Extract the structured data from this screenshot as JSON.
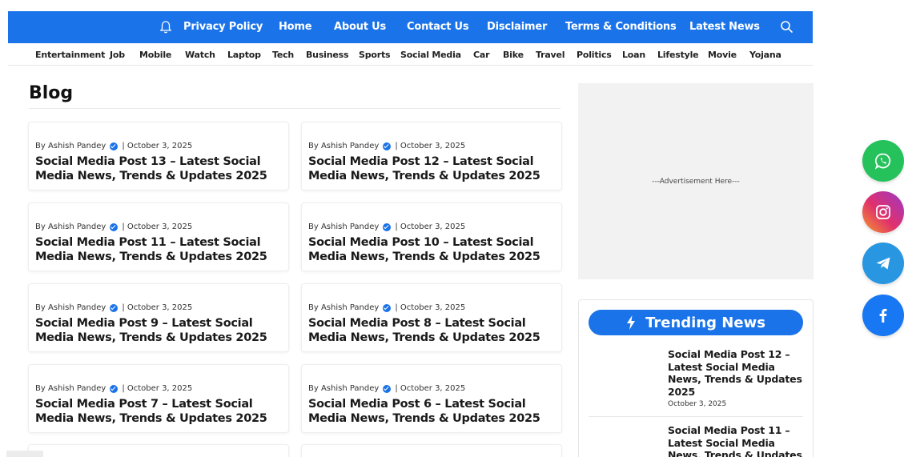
{
  "topnav": {
    "links": [
      "Privacy Policy",
      "Home",
      "About Us",
      "Contact Us",
      "Disclaimer",
      "Terms & Conditions",
      "Latest News"
    ],
    "bell_icon": "bell-icon",
    "search_icon": "search-icon",
    "bg_color": "#1a73e8"
  },
  "categories": [
    "Entertainment",
    "Job",
    "Mobile",
    "Watch",
    "Laptop",
    "Tech",
    "Business",
    "Sports",
    "Social Media",
    "Car",
    "Bike",
    "Travel",
    "Politics",
    "Loan",
    "Lifestyle",
    "Movie",
    "Yojana"
  ],
  "blog": {
    "heading": "Blog",
    "posts": [
      {
        "author": "By Ashish Pandey",
        "date": "| October 3, 2025",
        "title": "Social Media Post 13 – Latest Social Media News, Trends & Updates 2025"
      },
      {
        "author": "By Ashish Pandey",
        "date": "| October 3, 2025",
        "title": "Social Media Post 12 – Latest Social Media News, Trends & Updates 2025"
      },
      {
        "author": "By Ashish Pandey",
        "date": "| October 3, 2025",
        "title": "Social Media Post 11 – Latest Social Media News, Trends & Updates 2025"
      },
      {
        "author": "By Ashish Pandey",
        "date": "| October 3, 2025",
        "title": "Social Media Post 10 – Latest Social Media News, Trends & Updates 2025"
      },
      {
        "author": "By Ashish Pandey",
        "date": "| October 3, 2025",
        "title": "Social Media Post 9 – Latest Social Media News, Trends & Updates 2025"
      },
      {
        "author": "By Ashish Pandey",
        "date": "| October 3, 2025",
        "title": "Social Media Post 8 – Latest Social Media News, Trends & Updates 2025"
      },
      {
        "author": "By Ashish Pandey",
        "date": "| October 3, 2025",
        "title": "Social Media Post 7 – Latest Social Media News, Trends & Updates 2025"
      },
      {
        "author": "By Ashish Pandey",
        "date": "| October 3, 2025",
        "title": "Social Media Post 6 – Latest Social Media News, Trends & Updates 2025"
      }
    ]
  },
  "sidebar": {
    "ad_text": "---Advertisement Here---",
    "trending": {
      "heading": "Trending News",
      "items": [
        {
          "title": "Social Media Post 12 – Latest Social Media News, Trends & Updates 2025",
          "date": "October 3, 2025"
        },
        {
          "title": "Social Media Post 11 – Latest Social Media News, Trends & Updates",
          "date": ""
        }
      ]
    }
  },
  "social_icons": [
    "whatsapp-icon",
    "instagram-icon",
    "telegram-icon",
    "facebook-icon"
  ]
}
